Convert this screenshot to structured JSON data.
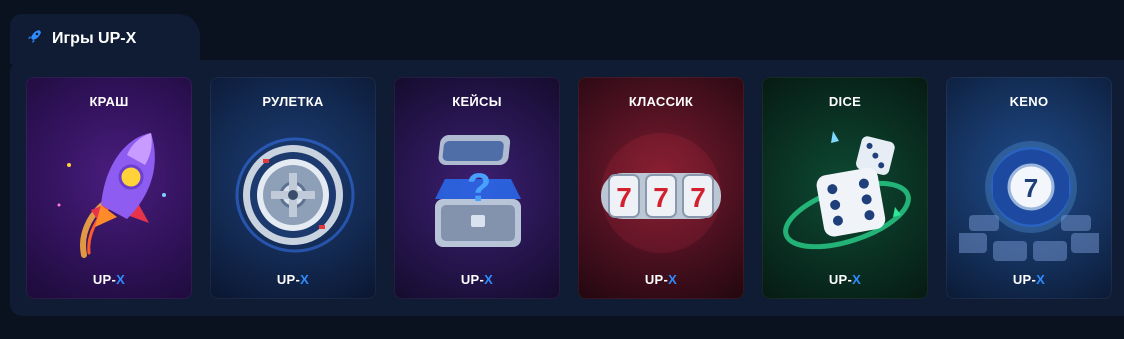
{
  "section": {
    "title": "Игры UP-X",
    "icon": "rocket-icon"
  },
  "games": [
    {
      "title": "КРАШ",
      "icon": "rocket-icon",
      "brand_main": "UP-",
      "brand_accent": "X"
    },
    {
      "title": "РУЛЕТКА",
      "icon": "roulette-wheel-icon",
      "brand_main": "UP-",
      "brand_accent": "X"
    },
    {
      "title": "КЕЙСЫ",
      "icon": "mystery-box-icon",
      "brand_main": "UP-",
      "brand_accent": "X"
    },
    {
      "title": "КЛАССИК",
      "icon": "slot-777-icon",
      "brand_main": "UP-",
      "brand_accent": "X"
    },
    {
      "title": "DICE",
      "icon": "dice-icon",
      "brand_main": "UP-",
      "brand_accent": "X"
    },
    {
      "title": "KENO",
      "icon": "keno-ball-icon",
      "brand_main": "UP-",
      "brand_accent": "X"
    }
  ],
  "colors": {
    "background": "#0a1220",
    "panel": "#101c33",
    "accent": "#2e8cff"
  }
}
